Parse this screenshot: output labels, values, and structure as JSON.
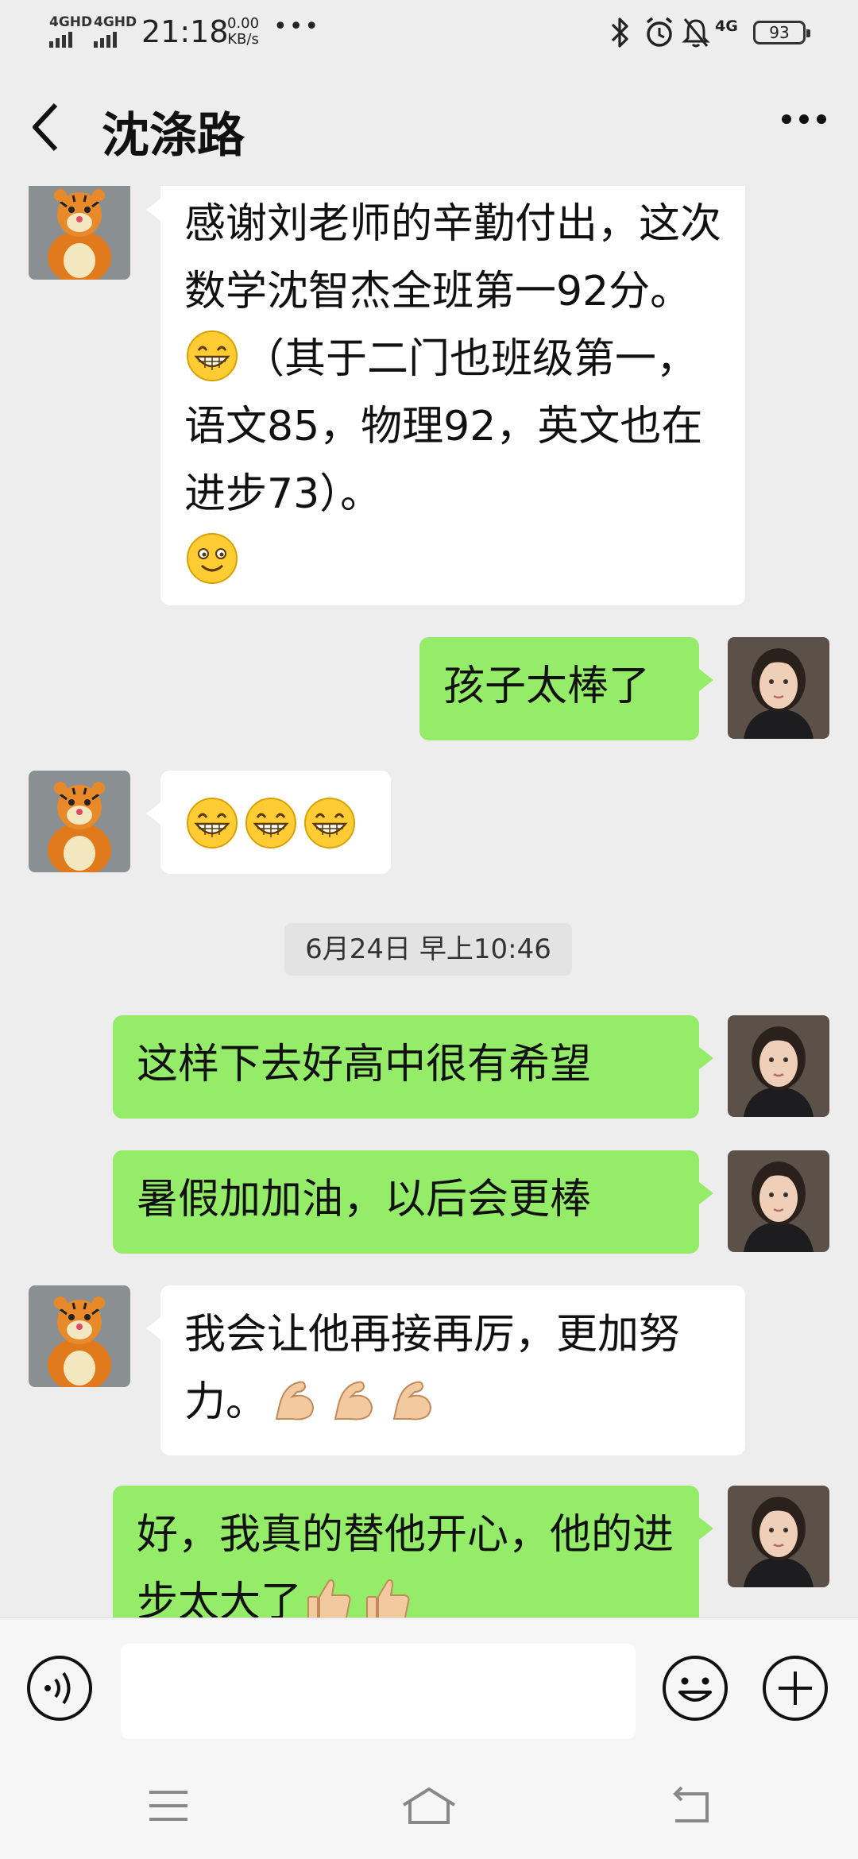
{
  "status_bar": {
    "sim1": "4GHD",
    "sim2": "4GHD",
    "time": "21:18",
    "speed_value": "0.00",
    "speed_unit": "KB/s",
    "more": "•••",
    "network": "4G",
    "battery": "93"
  },
  "header": {
    "title": "沈涤路"
  },
  "messages": [
    {
      "side": "in",
      "text": "感谢刘老师的辛勤付出，这次数学沈智杰全班第一92分。",
      "text2": "（其于二门也班级第一，语文85，物理92，英文也在进步73）。"
    },
    {
      "side": "out",
      "text": "孩子太棒了"
    },
    {
      "side": "in",
      "text": ""
    },
    {
      "side": "out",
      "text": "这样下去好高中很有希望"
    },
    {
      "side": "out",
      "text": "暑假加加油，以后会更棒"
    },
    {
      "side": "in",
      "text": "我会让他再接再厉，更加努力。"
    },
    {
      "side": "out",
      "text": "好，我真的替他开心，他的进步太大了"
    }
  ],
  "timestamp": "6月24日 早上10:46",
  "colors": {
    "outgoing_bubble": "#95ec69",
    "incoming_bubble": "#ffffff",
    "background": "#ededed"
  },
  "icons": {
    "grin": "grinning-face-icon",
    "smile": "smiling-face-icon",
    "muscle": "flexed-biceps-icon",
    "thumbs": "thumbs-up-icon"
  }
}
